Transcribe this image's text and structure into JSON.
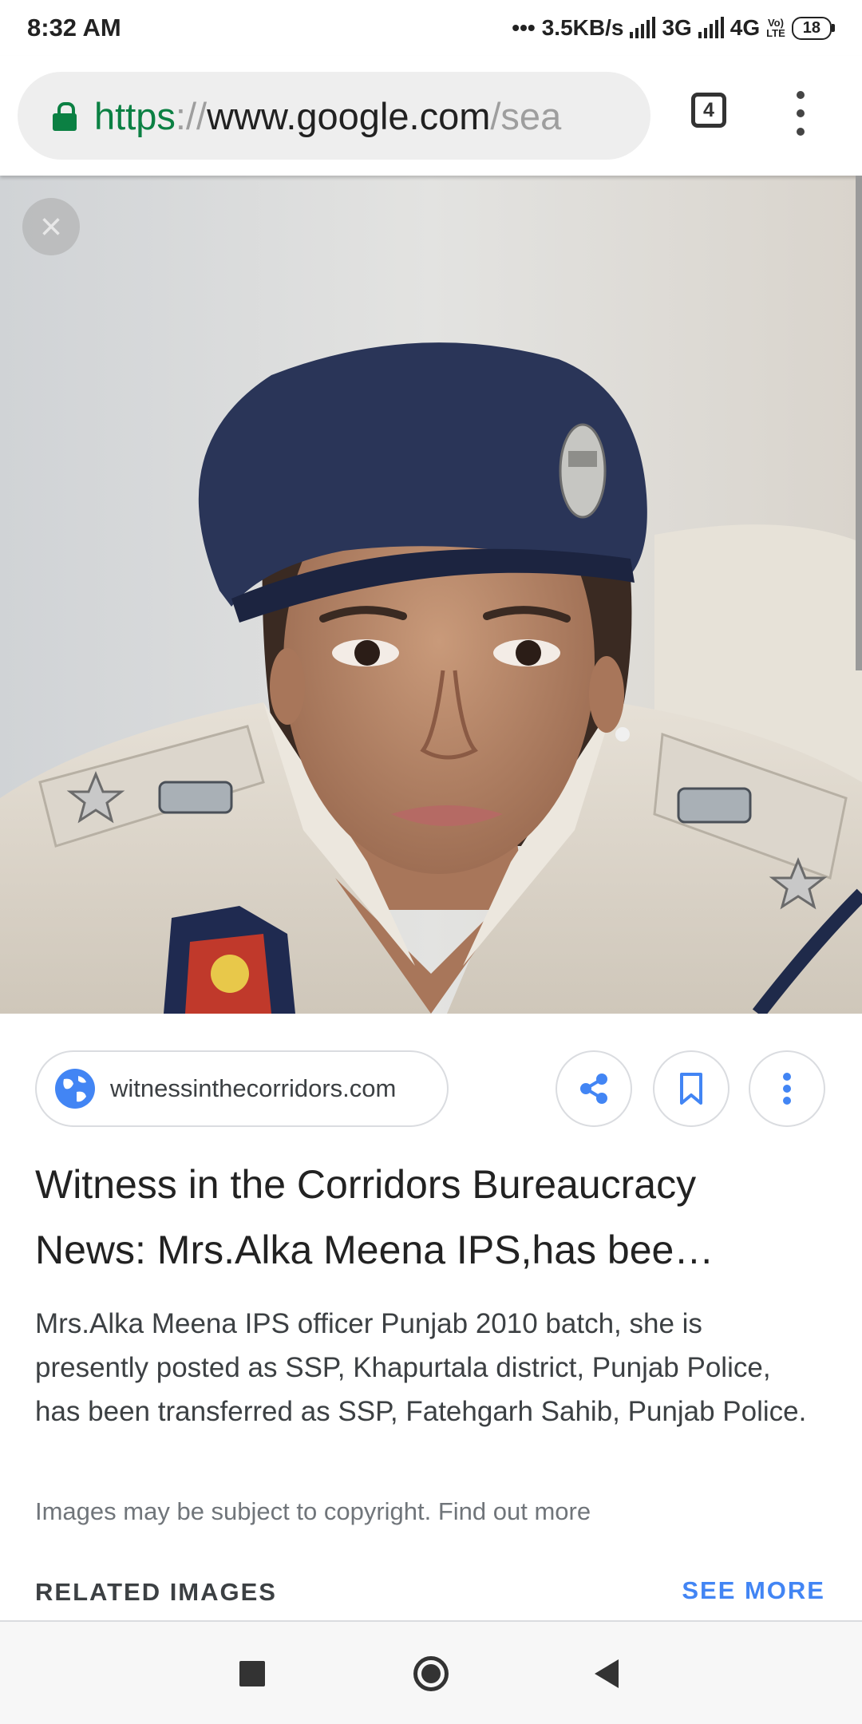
{
  "status_bar": {
    "time": "8:32 AM",
    "dots": "•••",
    "speed": "3.5KB/s",
    "network1": "3G",
    "network2": "4G",
    "net_badge_top": "Vo)",
    "net_badge_bottom": "LTE",
    "battery": "18"
  },
  "browser": {
    "url_scheme": "https",
    "url_sep": "://",
    "url_host": "www.google.com",
    "url_path": "/sea",
    "tab_count": "4"
  },
  "viewer": {
    "close_glyph": "×",
    "source": "witnessinthecorridors.com",
    "title": "Witness in the Corridors Bureaucracy News: Mrs.Alka Meena IPS,has bee…",
    "snippet": "Mrs.Alka Meena IPS officer Punjab 2010 batch, she is presently posted as SSP, Khapurtala district, Punjab Police, has been transferred as SSP, Fatehgarh Sahib, Punjab Police.",
    "copyright": "Images may be subject to copyright. Find out more",
    "related_label": "RELATED IMAGES",
    "see_more": "SEE MORE"
  },
  "colors": {
    "secure_green": "#0b8043",
    "accent_blue": "#4285f4",
    "beret_navy": "#2a3558"
  },
  "icons": [
    "lock-icon",
    "tabs-icon",
    "more-vert-icon",
    "close-icon",
    "globe-icon",
    "share-icon",
    "bookmark-icon",
    "recents-icon",
    "home-icon",
    "back-icon"
  ]
}
